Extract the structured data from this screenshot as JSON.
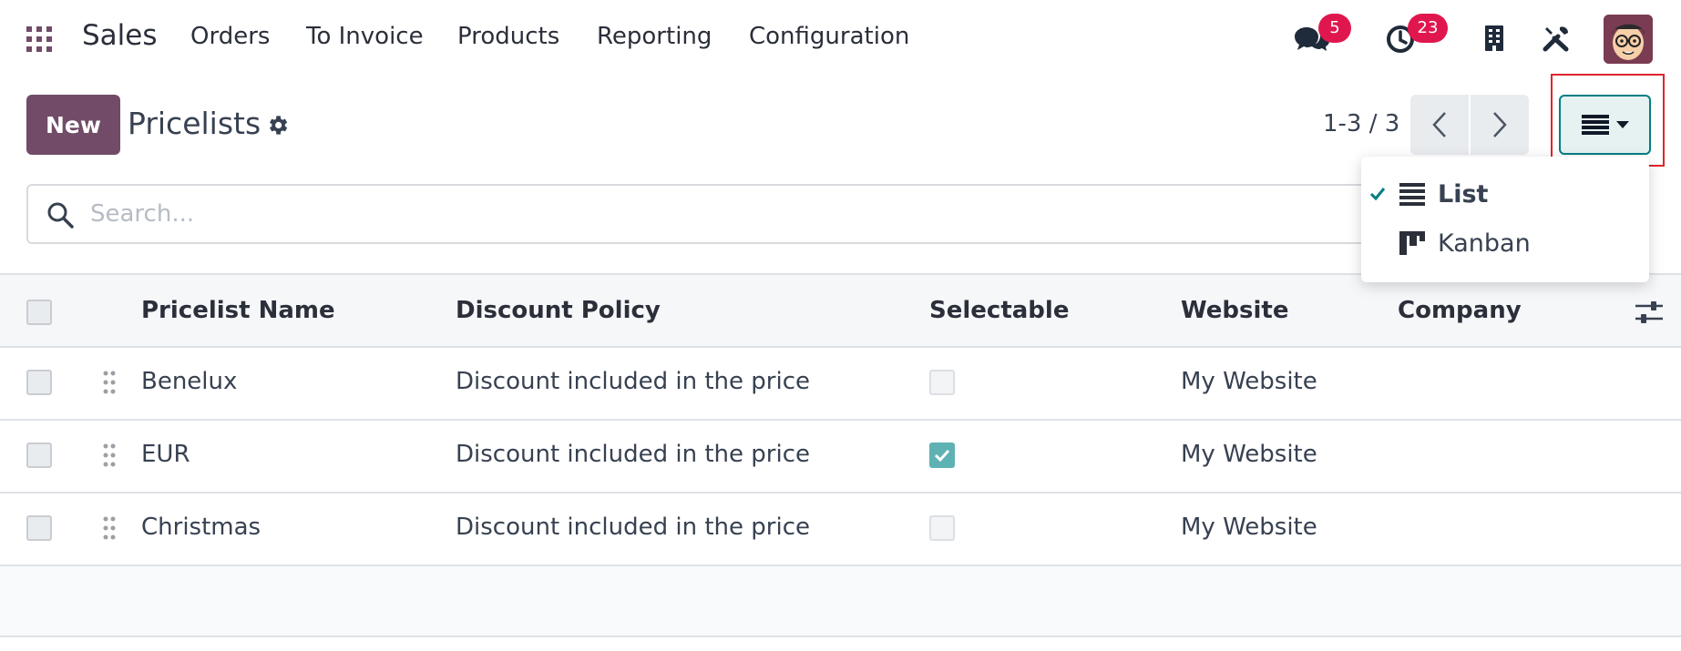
{
  "navbar": {
    "app_name": "Sales",
    "menu": [
      "Orders",
      "To Invoice",
      "Products",
      "Reporting",
      "Configuration"
    ],
    "messages_count": "5",
    "activities_count": "23"
  },
  "control_panel": {
    "new_label": "New",
    "title": "Pricelists",
    "pager_value": "1-3 / 3"
  },
  "search": {
    "placeholder": "Search..."
  },
  "view_dropdown": {
    "items": [
      {
        "label": "List",
        "selected": true,
        "icon": "list-icon"
      },
      {
        "label": "Kanban",
        "selected": false,
        "icon": "kanban-icon"
      }
    ]
  },
  "table": {
    "columns": [
      "Pricelist Name",
      "Discount Policy",
      "Selectable",
      "Website",
      "Company"
    ],
    "rows": [
      {
        "name": "Benelux",
        "discount_policy": "Discount included in the price",
        "selectable": false,
        "website": "My Website",
        "company": ""
      },
      {
        "name": "EUR",
        "discount_policy": "Discount included in the price",
        "selectable": true,
        "website": "My Website",
        "company": ""
      },
      {
        "name": "Christmas",
        "discount_policy": "Discount included in the price",
        "selectable": false,
        "website": "My Website",
        "company": ""
      }
    ]
  },
  "colors": {
    "brand": "#714b67",
    "accent": "#017e84",
    "badge": "#e0174f",
    "highlight": "#e0242e"
  }
}
